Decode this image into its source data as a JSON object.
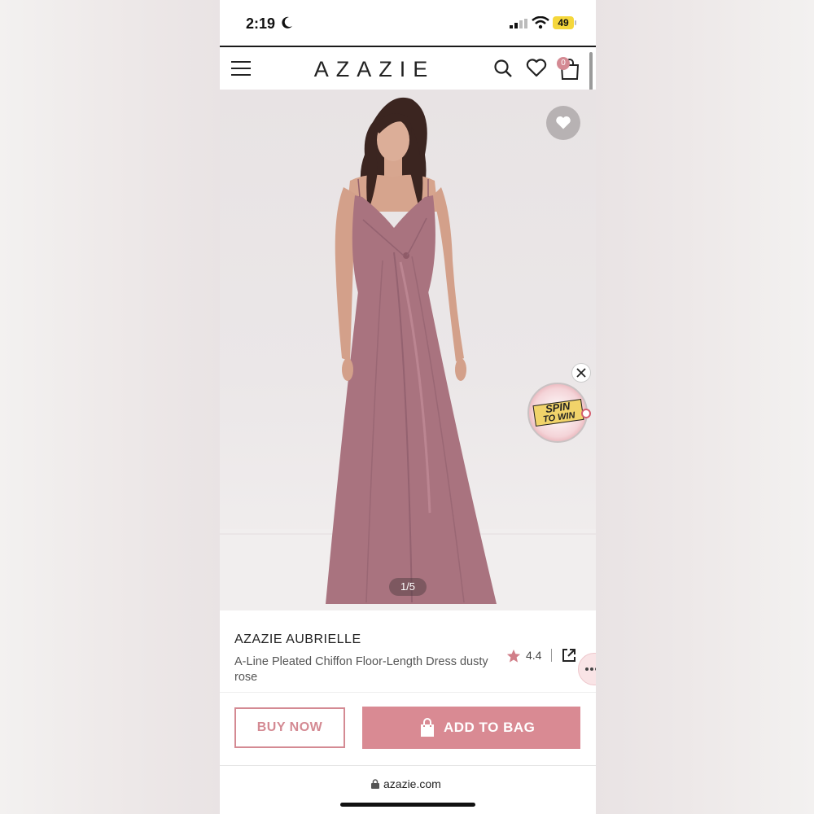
{
  "status_bar": {
    "time": "2:19",
    "battery": "49"
  },
  "header": {
    "logo": "AZAZIE",
    "cart_count": "0"
  },
  "gallery": {
    "pager": "1/5"
  },
  "promo": {
    "spin_line1": "SPIN",
    "spin_line2": "TO WIN"
  },
  "product": {
    "brand": "AZAZIE AUBRIELLE",
    "name": "A-Line Pleated Chiffon Floor-Length Dress dusty rose",
    "rating": "4.4"
  },
  "actions": {
    "buy_now": "BUY NOW",
    "add_to_bag": "ADD TO BAG"
  },
  "browser": {
    "url": "azazie.com"
  },
  "colors": {
    "accent": "#d98a93",
    "dress": "#a9737f"
  }
}
